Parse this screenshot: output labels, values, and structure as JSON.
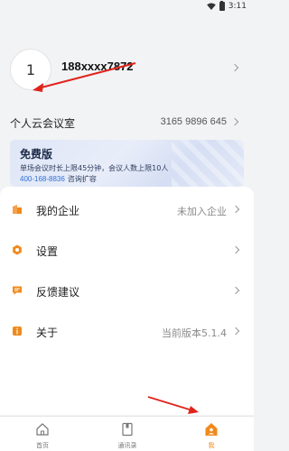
{
  "status_bar": {
    "time": "3:11",
    "wifi_icon": "wifi-icon",
    "battery_icon": "battery-icon"
  },
  "profile": {
    "avatar_text": "1",
    "phone": "188xxxx7872",
    "personal_room_label": "个人云会议室",
    "personal_room_number": "3165 9896 645"
  },
  "plan_card": {
    "title": "免费版",
    "description": "单场会议时长上限45分钟，会议人数上限10人",
    "hotline": "400-168-8836",
    "hotline_text": "咨询扩容"
  },
  "menu": {
    "items": [
      {
        "label": "我的企业",
        "value": "未加入企业",
        "icon": "enterprise-icon"
      },
      {
        "label": "设置",
        "value": "",
        "icon": "settings-icon"
      },
      {
        "label": "反馈建议",
        "value": "",
        "icon": "feedback-icon"
      },
      {
        "label": "关于",
        "value": "当前版本5.1.4",
        "icon": "info-icon"
      }
    ]
  },
  "tabbar": {
    "tabs": [
      {
        "label": "首页",
        "icon": "home-icon",
        "active": false
      },
      {
        "label": "通讯录",
        "icon": "contacts-icon",
        "active": false
      },
      {
        "label": "我",
        "icon": "me-icon",
        "active": true
      }
    ]
  },
  "colors": {
    "accent": "#f08a1c",
    "annotation_arrow": "#e0241c",
    "hotline": "#2f6fd8"
  }
}
